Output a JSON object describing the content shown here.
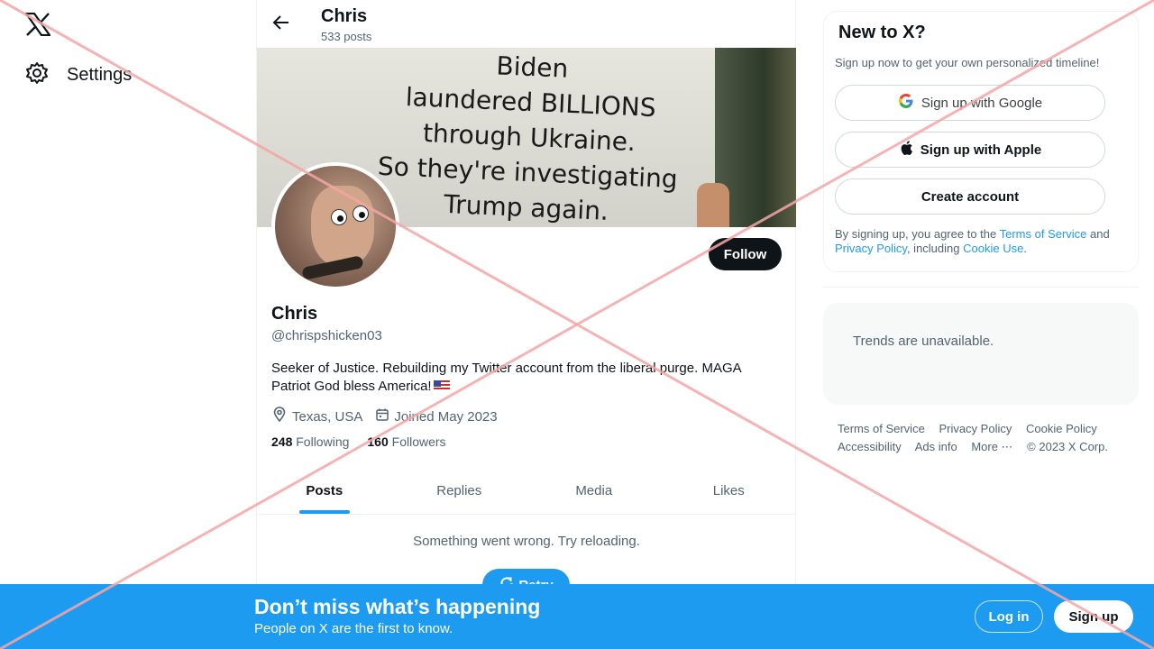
{
  "nav": {
    "logo_icon": "x-logo-icon",
    "settings_label": "Settings"
  },
  "header": {
    "name": "Chris",
    "posts_count": "533 posts"
  },
  "banner": {
    "text_lines": [
      "Biden",
      "laundered BILLIONS",
      "through Ukraine.",
      "So they're investigating",
      "Trump again."
    ]
  },
  "profile": {
    "follow_label": "Follow",
    "name": "Chris",
    "handle": "@chrispshicken03",
    "bio": "Seeker of Justice. Rebuilding my Twitter account from the liberal purge. MAGA Patriot God bless America!",
    "location": "Texas, USA",
    "joined": "Joined May 2023",
    "following_count": "248",
    "following_label": "Following",
    "followers_count": "160",
    "followers_label": "Followers"
  },
  "tabs": [
    {
      "label": "Posts",
      "active": true
    },
    {
      "label": "Replies",
      "active": false
    },
    {
      "label": "Media",
      "active": false
    },
    {
      "label": "Likes",
      "active": false
    }
  ],
  "feed": {
    "error_message": "Something went wrong. Try reloading.",
    "retry_label": "Retry"
  },
  "signup_card": {
    "title": "New to X?",
    "subtitle": "Sign up now to get your own personalized timeline!",
    "google_label": "Sign up with Google",
    "apple_label": "Sign up with Apple",
    "create_label": "Create account",
    "legal_prefix": "By signing up, you agree to the ",
    "terms_link": "Terms of Service",
    "legal_and": " and ",
    "privacy_link": "Privacy Policy",
    "legal_including": ", including ",
    "cookie_link": "Cookie Use",
    "legal_end": "."
  },
  "trends": {
    "message": "Trends are unavailable."
  },
  "footer": {
    "links": [
      "Terms of Service",
      "Privacy Policy",
      "Cookie Policy",
      "Accessibility",
      "Ads info",
      "More ⋯"
    ],
    "copyright": "© 2023 X Corp."
  },
  "bottom_bar": {
    "title": "Don’t miss what’s happening",
    "subtitle": "People on X are the first to know.",
    "login_label": "Log in",
    "signup_label": "Sign up"
  },
  "colors": {
    "accent": "#1d9bf0",
    "text": "#0f1419",
    "muted": "#536471",
    "overlay_x": "#f4a6a6"
  }
}
